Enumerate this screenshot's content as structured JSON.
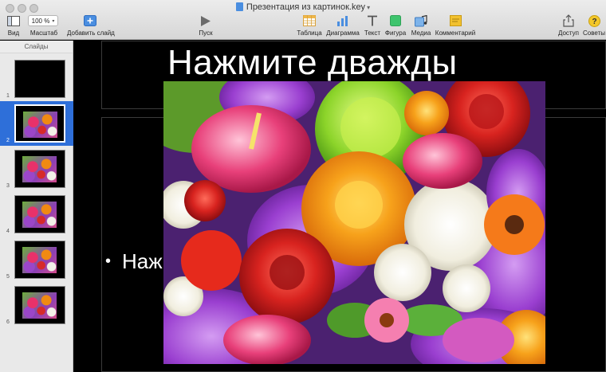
{
  "window": {
    "title": "Презентация из картинок.key"
  },
  "toolbar": {
    "view_label": "Вид",
    "zoom_value": "100 %",
    "zoom_label": "Масштаб",
    "add_slide_label": "Добавить слайд",
    "play_label": "Пуск",
    "table_label": "Таблица",
    "chart_label": "Диаграмма",
    "text_label": "Текст",
    "shape_label": "Фигура",
    "media_label": "Медиа",
    "comment_label": "Комментарий",
    "share_label": "Доступ",
    "tips_label": "Советы"
  },
  "sidebar": {
    "title": "Слайды",
    "slides": [
      {
        "number": "1",
        "has_image": false,
        "selected": false
      },
      {
        "number": "2",
        "has_image": true,
        "selected": true
      },
      {
        "number": "3",
        "has_image": true,
        "selected": false
      },
      {
        "number": "4",
        "has_image": true,
        "selected": false
      },
      {
        "number": "5",
        "has_image": true,
        "selected": false
      },
      {
        "number": "6",
        "has_image": true,
        "selected": false
      }
    ]
  },
  "canvas": {
    "title_text": "Нажмите дважды",
    "bullet_text": "Наж",
    "image_subject": "flower-bouquet"
  },
  "colors": {
    "toolbar_bg": "#e0e0e0",
    "selection": "#2e6fd9",
    "canvas_bg": "#000000",
    "accent_blue": "#4a8ee0",
    "shape_green": "#3ec46d",
    "comment_yellow": "#f2c12e"
  }
}
